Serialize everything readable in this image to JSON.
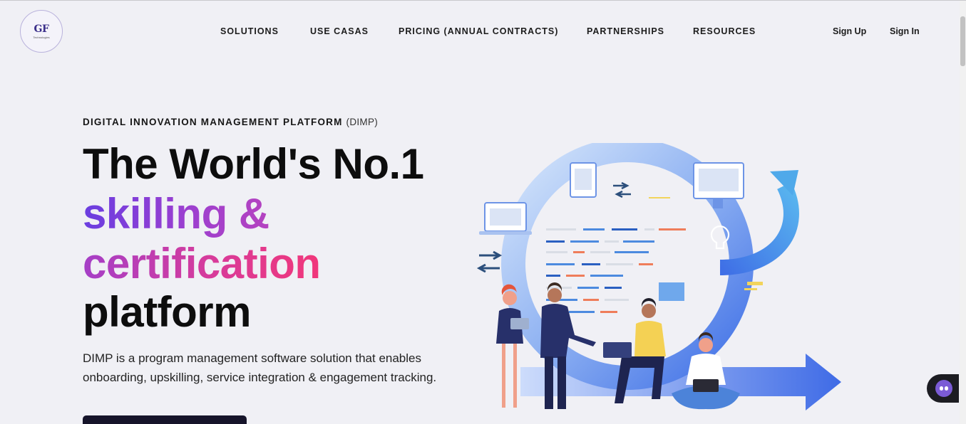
{
  "logo": {
    "mark": "GF",
    "sub": "Technologies"
  },
  "nav": {
    "items": [
      "SOLUTIONS",
      "USE CASAS",
      "PRICING (ANNUAL CONTRACTS)",
      "PARTNERSHIPS",
      "RESOURCES"
    ]
  },
  "auth": {
    "sign_up": "Sign Up",
    "sign_in": "Sign In"
  },
  "hero": {
    "eyebrow_bold": "DIGITAL INNOVATION MANAGEMENT PLATFORM",
    "eyebrow_light": "(DIMP)",
    "headline_line1": "The World's No.1",
    "headline_line2": "skilling &",
    "headline_line3": "certification",
    "headline_line4": "platform",
    "description": "DIMP is a program management software solution that enables onboarding, upskilling, service integration & engagement tracking."
  },
  "colors": {
    "accent_purple": "#6a3ee0",
    "accent_pink": "#f1377a",
    "cta_bg": "#16142a",
    "illustration_blue": "#4c7bea"
  },
  "icons": {
    "chat": "chatbot-face-icon"
  }
}
